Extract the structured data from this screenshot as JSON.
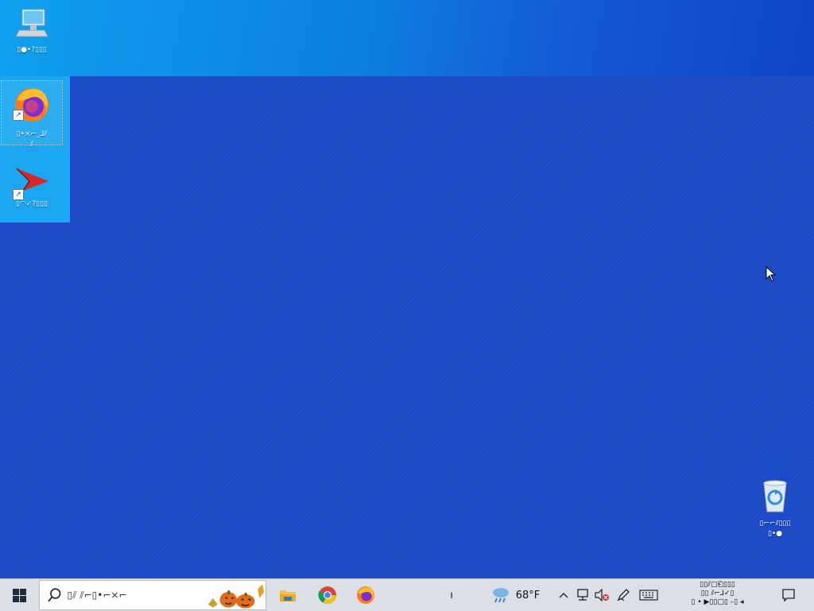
{
  "desktop": {
    "icons": [
      {
        "name": "this-pc",
        "label": "▯●•?▯▯▯",
        "kind": "computer"
      },
      {
        "name": "firefox",
        "label": "▯•×⌐_⅃⫽",
        "label2": "⫽",
        "kind": "firefox"
      },
      {
        "name": "app-red-arrow",
        "label": "▯◠✓?▯▯▯",
        "kind": "red-arrow"
      },
      {
        "name": "recycle-bin",
        "label": "▯⌐⌐⫽▯▯▯",
        "label2": "▯•●",
        "kind": "recycle-bin"
      }
    ]
  },
  "taskbar": {
    "search_placeholder": "▯⫽ ⫽⌐▯•⌐×⌐",
    "apps": [
      "file-explorer",
      "chrome",
      "firefox"
    ],
    "weather_temp": "68°F",
    "divider_text": "ı",
    "clock": {
      "time": "▯▯⫽▢⎗▯▯▯",
      "date_line1": "▯▯ ⫽⌐⅃✓▯",
      "date_line2": "▯ • ▶▯▯▢▯ –▯ ◂"
    },
    "tray_icons": [
      "chevron-up-icon",
      "network-icon",
      "volume-muted-icon",
      "pen-icon",
      "keyboard-icon"
    ],
    "notification_icon": "notification-icon"
  },
  "colors": {
    "desktop_bg": "#1a49c6",
    "wallpaper_top": "#0fa1ee",
    "taskbar_bg": "#dcdfe6",
    "start_blue": "#0078d7"
  }
}
